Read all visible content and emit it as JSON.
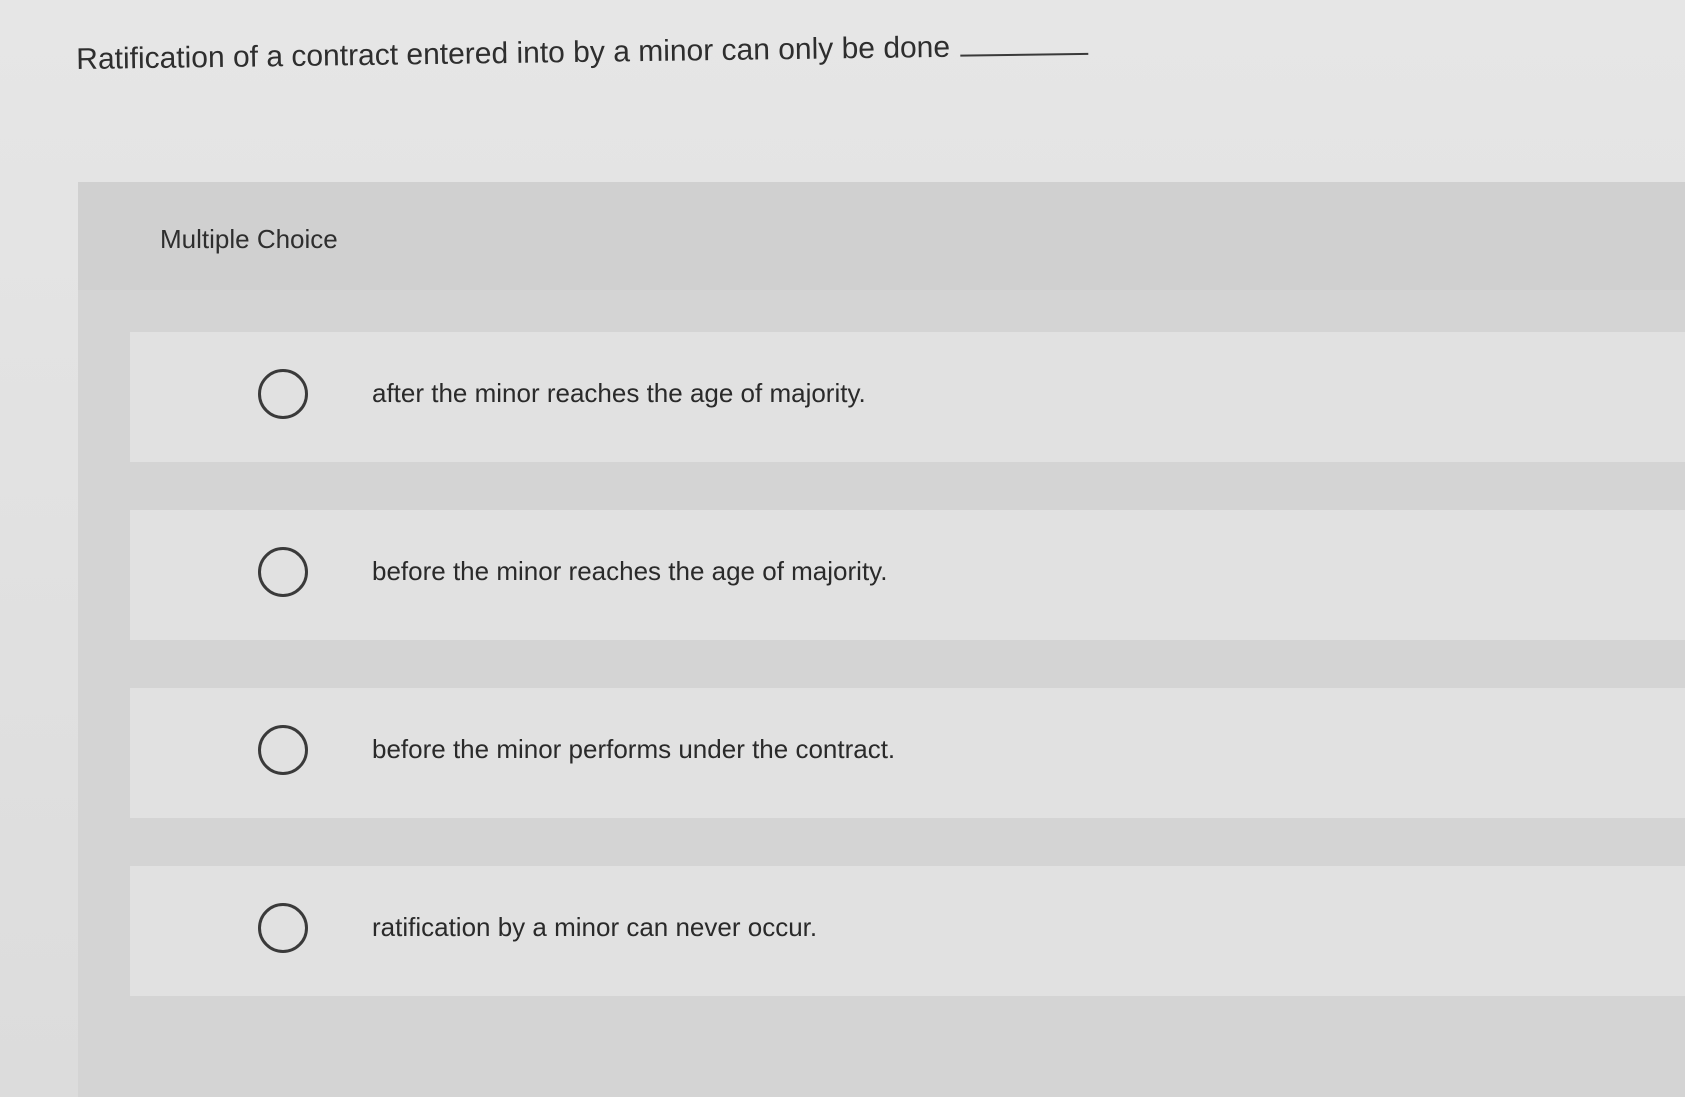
{
  "question": {
    "text": "Ratification of a contract entered into by a minor can only be done"
  },
  "panel": {
    "header_label": "Multiple Choice"
  },
  "options": [
    {
      "label": "after the minor reaches the age of majority.",
      "selected": false
    },
    {
      "label": "before the minor reaches the age of majority.",
      "selected": false
    },
    {
      "label": "before the minor performs under the contract.",
      "selected": false
    },
    {
      "label": "ratification by a minor can never occur.",
      "selected": false
    }
  ]
}
